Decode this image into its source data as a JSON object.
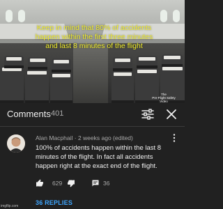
{
  "video": {
    "caption_line1": "Keep in mind that 80% of accidents",
    "caption_line2": "happen within the first three minutes",
    "caption_line3": "and last 8 minutes of the flight",
    "watermark_line1": "The",
    "watermark_line2": "Pre-Flight Safety",
    "watermark_line3": "Video"
  },
  "comments_header": {
    "title": "Comments",
    "count": "401",
    "sort_icon": "sort-filter-icon",
    "close_icon": "close-icon"
  },
  "comment": {
    "author": "Alan Macphail",
    "meta": "Alan Macphail · 2 weeks ago (edited)",
    "text": "100% of accidents happen within the last 8 minutes of the flight. In fact all accidents happen right at the exact end of the flight.",
    "likes": "629",
    "replies_count": "36",
    "view_replies_label": "36 REPLIES",
    "icons": [
      "thumbs-up-icon",
      "thumbs-down-icon",
      "reply-icon",
      "more-vert-icon"
    ]
  },
  "colors": {
    "background": "#212121",
    "caption_yellow": "#f2ee2a",
    "link_blue": "#3ea6ff",
    "secondary_text": "#aaaaaa"
  },
  "corner_mark": "imgflip.com"
}
